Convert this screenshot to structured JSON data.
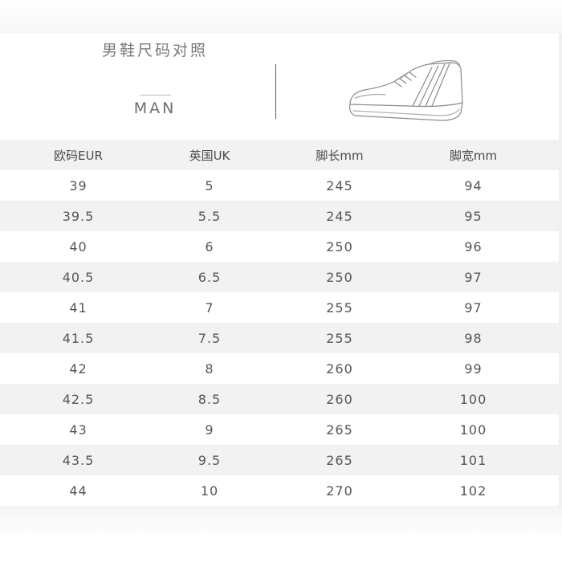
{
  "header": {
    "title": "男鞋尺码对照",
    "subtitle": "MAN"
  },
  "icons": {
    "shoe": "sneaker-icon"
  },
  "table": {
    "columns": [
      "欧码EUR",
      "英国UK",
      "脚长mm",
      "脚宽mm"
    ],
    "rows": [
      [
        "39",
        "5",
        "245",
        "94"
      ],
      [
        "39.5",
        "5.5",
        "245",
        "95"
      ],
      [
        "40",
        "6",
        "250",
        "96"
      ],
      [
        "40.5",
        "6.5",
        "250",
        "97"
      ],
      [
        "41",
        "7",
        "255",
        "97"
      ],
      [
        "41.5",
        "7.5",
        "255",
        "98"
      ],
      [
        "42",
        "8",
        "260",
        "99"
      ],
      [
        "42.5",
        "8.5",
        "260",
        "100"
      ],
      [
        "43",
        "9",
        "265",
        "100"
      ],
      [
        "43.5",
        "9.5",
        "265",
        "101"
      ],
      [
        "44",
        "10",
        "270",
        "102"
      ]
    ]
  },
  "colors": {
    "stripe": "#f2f2f2",
    "text": "#555555"
  }
}
